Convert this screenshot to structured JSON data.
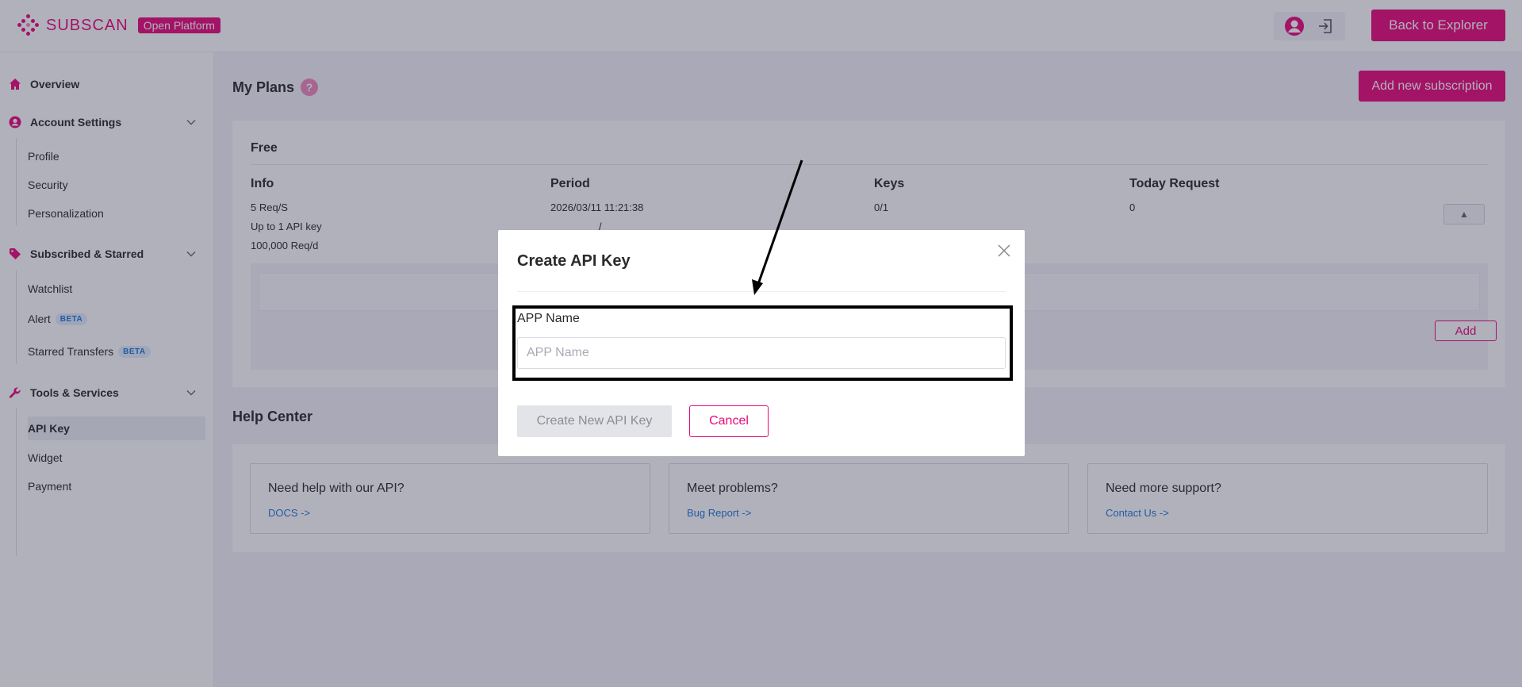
{
  "header": {
    "brand": "SUBSCAN",
    "platform_badge": "Open Platform",
    "back_button": "Back to Explorer"
  },
  "sidebar": {
    "overview": "Overview",
    "account_settings": {
      "label": "Account Settings",
      "items": [
        "Profile",
        "Security",
        "Personalization"
      ]
    },
    "subscribed": {
      "label": "Subscribed & Starred",
      "items": [
        {
          "label": "Watchlist",
          "badge": ""
        },
        {
          "label": "Alert",
          "badge": "BETA"
        },
        {
          "label": "Starred Transfers",
          "badge": "BETA"
        }
      ]
    },
    "tools": {
      "label": "Tools & Services",
      "items": [
        "API Key",
        "Widget",
        "Payment"
      ],
      "active": "API Key"
    }
  },
  "main": {
    "plans_title": "My Plans",
    "help_mark": "?",
    "add_subscription": "Add new subscription",
    "plan": {
      "name": "Free",
      "columns": [
        "Info",
        "Period",
        "Keys",
        "Today Request"
      ],
      "info": [
        "5 Req/S",
        "Up to 1 API key",
        "100,000 Req/d"
      ],
      "period_start": "2026/03/11 11:21:38",
      "period_end": "/",
      "keys": "0/1",
      "today_request": "0",
      "toggle": "▲",
      "add_button": "Add"
    },
    "help_title": "Help Center",
    "help_cards": [
      {
        "title": "Need help with our API?",
        "link": "DOCS ->"
      },
      {
        "title": "Meet problems?",
        "link": "Bug Report ->"
      },
      {
        "title": "Need more support?",
        "link": "Contact Us ->"
      }
    ]
  },
  "modal": {
    "title": "Create API Key",
    "field_label": "APP Name",
    "field_placeholder": "APP Name",
    "field_value": "",
    "create_button": "Create New API Key",
    "cancel_button": "Cancel"
  },
  "colors": {
    "accent": "#e90979",
    "link": "#1d7bd7",
    "overlay": "rgba(40,38,70,0.36)"
  }
}
